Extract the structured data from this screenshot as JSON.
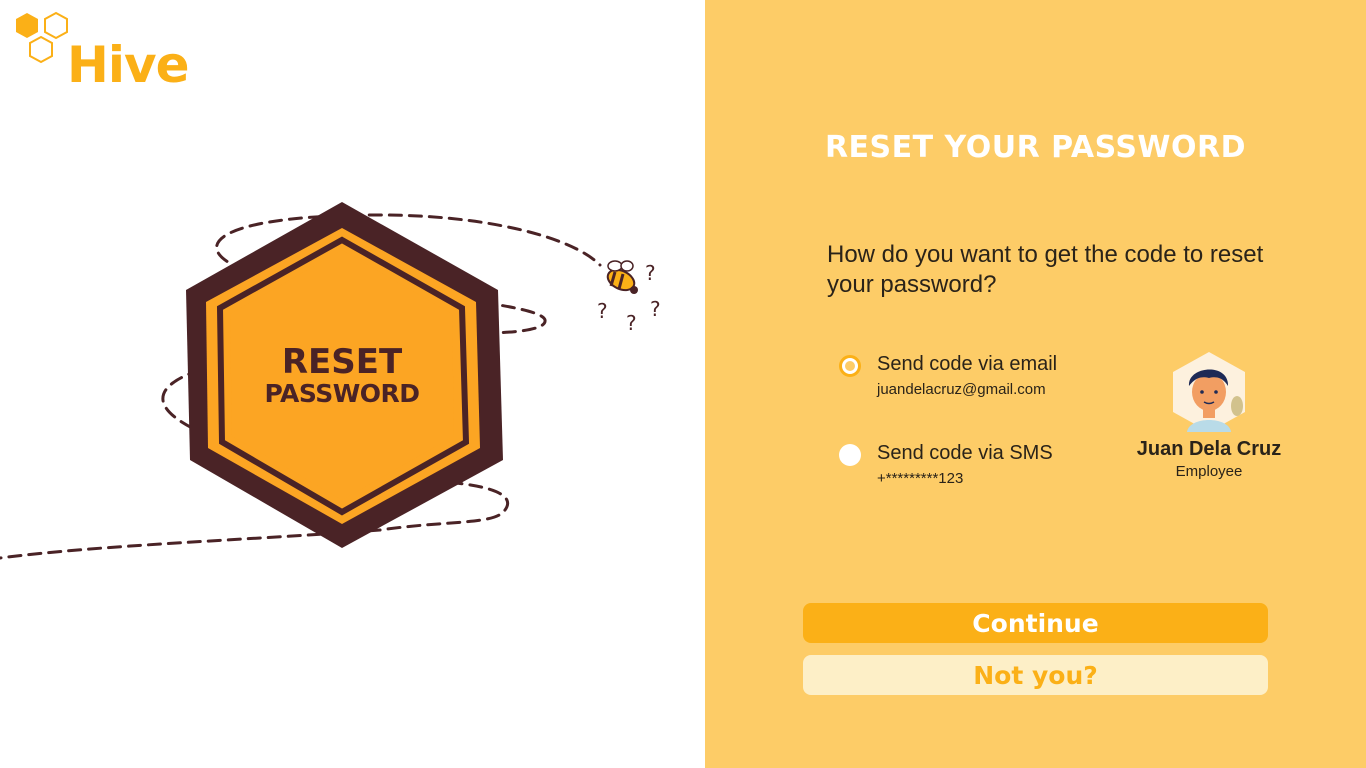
{
  "brand": {
    "name": "Hive",
    "color": "#fbb017"
  },
  "illustration": {
    "badge_line1": "RESET",
    "badge_line2": "PASSWORD",
    "icons": [
      "hexagon-badge-icon",
      "bee-icon",
      "question-marks-icon"
    ]
  },
  "panel": {
    "title": "RESET YOUR PASSWORD",
    "question": "How do you want to get the code to reset your password?",
    "options": [
      {
        "label": "Send code via email",
        "detail": "juandelacruz@gmail.com",
        "selected": true
      },
      {
        "label": "Send code via SMS",
        "detail": "+*********123",
        "selected": false
      }
    ],
    "user": {
      "name": "Juan Dela Cruz",
      "role": "Employee"
    },
    "continue_label": "Continue",
    "not_you_label": "Not you?"
  },
  "colors": {
    "panel_bg": "#fdcc67",
    "accent": "#fbb017",
    "badge_dark": "#4a2326",
    "badge_orange": "#fca523"
  }
}
